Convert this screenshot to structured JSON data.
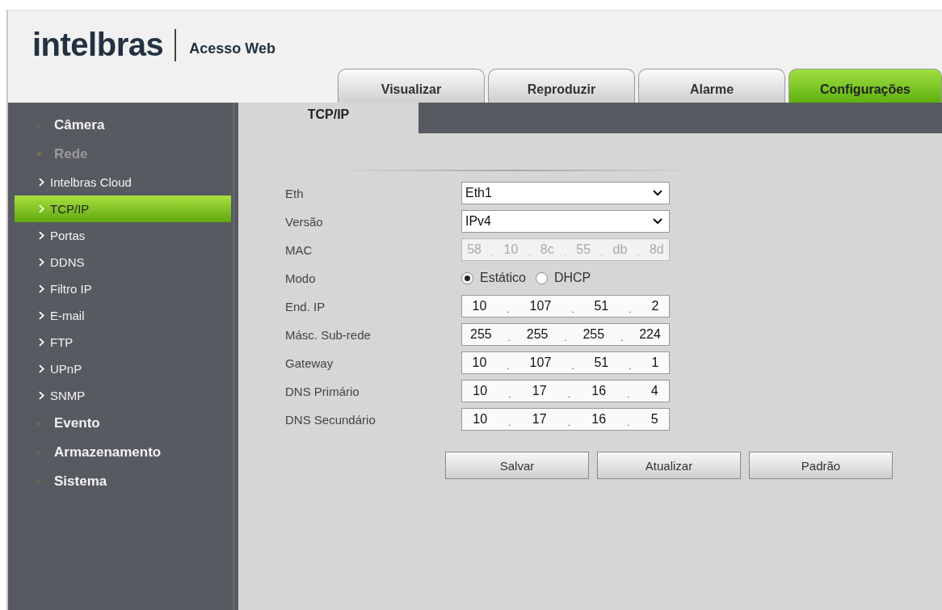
{
  "header": {
    "logo": "intelbras",
    "subtitle": "Acesso Web"
  },
  "tabs": [
    {
      "label": "Visualizar",
      "selected": false
    },
    {
      "label": "Reproduzir",
      "selected": false
    },
    {
      "label": "Alarme",
      "selected": false
    },
    {
      "label": "Configurações",
      "selected": true
    }
  ],
  "sidebar": {
    "items": [
      {
        "label": "Câmera",
        "expanded": false
      },
      {
        "label": "Rede",
        "expanded": true,
        "children": [
          {
            "label": "Intelbras Cloud",
            "selected": false
          },
          {
            "label": "TCP/IP",
            "selected": true
          },
          {
            "label": "Portas",
            "selected": false
          },
          {
            "label": "DDNS",
            "selected": false
          },
          {
            "label": "Filtro IP",
            "selected": false
          },
          {
            "label": "E-mail",
            "selected": false
          },
          {
            "label": "FTP",
            "selected": false
          },
          {
            "label": "UPnP",
            "selected": false
          },
          {
            "label": "SNMP",
            "selected": false
          }
        ]
      },
      {
        "label": "Evento",
        "expanded": false
      },
      {
        "label": "Armazenamento",
        "expanded": false
      },
      {
        "label": "Sistema",
        "expanded": false
      }
    ]
  },
  "panel_tab": "TCP/IP",
  "form": [
    {
      "kind": "select",
      "label": "Eth",
      "value": "Eth1"
    },
    {
      "kind": "select",
      "label": "Versão",
      "value": "IPv4"
    },
    {
      "kind": "address",
      "label": "MAC",
      "disabled": true,
      "parts": [
        "58",
        "10",
        "8c",
        "55",
        "db",
        "8d"
      ]
    },
    {
      "kind": "radio",
      "label": "Modo",
      "options": [
        {
          "label": "Estático",
          "selected": true
        },
        {
          "label": "DHCP",
          "selected": false
        }
      ]
    },
    {
      "kind": "address",
      "label": "End. IP",
      "disabled": false,
      "parts": [
        "10",
        "107",
        "51",
        "2"
      ]
    },
    {
      "kind": "address",
      "label": "Másc. Sub-rede",
      "disabled": false,
      "parts": [
        "255",
        "255",
        "255",
        "224"
      ]
    },
    {
      "kind": "address",
      "label": "Gateway",
      "disabled": false,
      "parts": [
        "10",
        "107",
        "51",
        "1"
      ]
    },
    {
      "kind": "address",
      "label": "DNS Primário",
      "disabled": false,
      "parts": [
        "10",
        "17",
        "16",
        "4"
      ]
    },
    {
      "kind": "address",
      "label": "DNS Secundário",
      "disabled": false,
      "parts": [
        "10",
        "17",
        "16",
        "5"
      ]
    }
  ],
  "separator": ".",
  "buttons": [
    "Salvar",
    "Atualizar",
    "Padrão"
  ]
}
